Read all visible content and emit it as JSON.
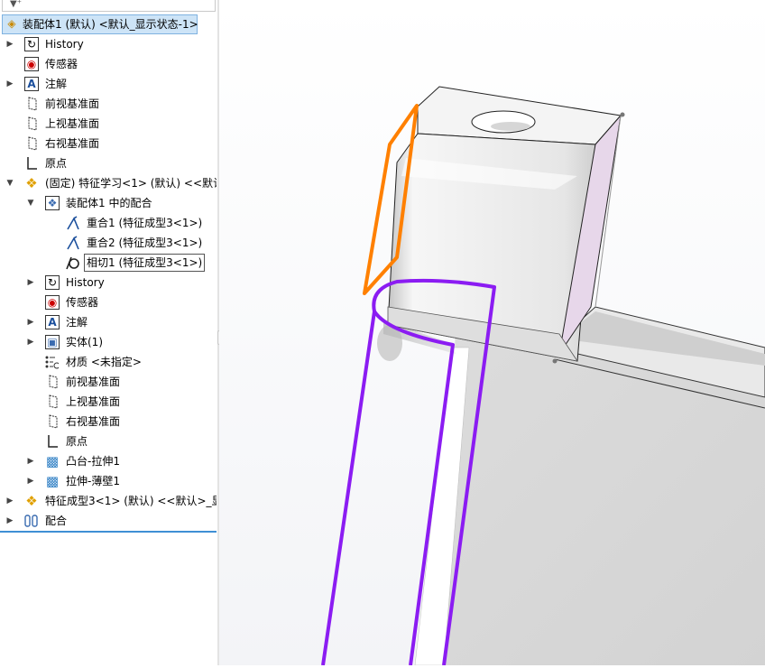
{
  "tree": {
    "filter_icon": "funnel-icon",
    "root_label": "装配体1 (默认) <默认_显示状态-1>",
    "items": [
      {
        "label": "History",
        "icon": "history-folder-icon"
      },
      {
        "label": "传感器",
        "icon": "sensor-icon"
      },
      {
        "label": "注解",
        "icon": "annotation-icon"
      },
      {
        "label": "前视基准面",
        "icon": "plane-icon"
      },
      {
        "label": "上视基准面",
        "icon": "plane-icon"
      },
      {
        "label": "右视基准面",
        "icon": "plane-icon"
      },
      {
        "label": "原点",
        "icon": "origin-icon"
      },
      {
        "label": "(固定) 特征学习<1> (默认) <<默认",
        "icon": "part-icon"
      },
      {
        "label": "装配体1 中的配合",
        "icon": "mates-folder-icon"
      },
      {
        "label": "重合1 (特征成型3<1>)",
        "icon": "coincident-icon"
      },
      {
        "label": "重合2 (特征成型3<1>)",
        "icon": "coincident-icon"
      },
      {
        "label": "相切1 (特征成型3<1>)",
        "icon": "tangent-icon"
      },
      {
        "label": "History",
        "icon": "history-folder-icon"
      },
      {
        "label": "传感器",
        "icon": "sensor-icon"
      },
      {
        "label": "注解",
        "icon": "annotation-icon"
      },
      {
        "label": "实体(1)",
        "icon": "solid-bodies-icon"
      },
      {
        "label": "材质 <未指定>",
        "icon": "material-icon"
      },
      {
        "label": "前视基准面",
        "icon": "plane-icon"
      },
      {
        "label": "上视基准面",
        "icon": "plane-icon"
      },
      {
        "label": "右视基准面",
        "icon": "plane-icon"
      },
      {
        "label": "原点",
        "icon": "origin-icon"
      },
      {
        "label": "凸台-拉伸1",
        "icon": "extrude-icon"
      },
      {
        "label": "拉伸-薄壁1",
        "icon": "extrude-icon"
      },
      {
        "label": "特征成型3<1> (默认) <<默认>_显",
        "icon": "part-icon"
      },
      {
        "label": "配合",
        "icon": "mates-folder-icon"
      }
    ]
  },
  "viewport": {
    "highlight_colors": {
      "orange": "#ff8000",
      "purple": "#8b1cf2",
      "face_pink": "#e7d7ea"
    }
  }
}
